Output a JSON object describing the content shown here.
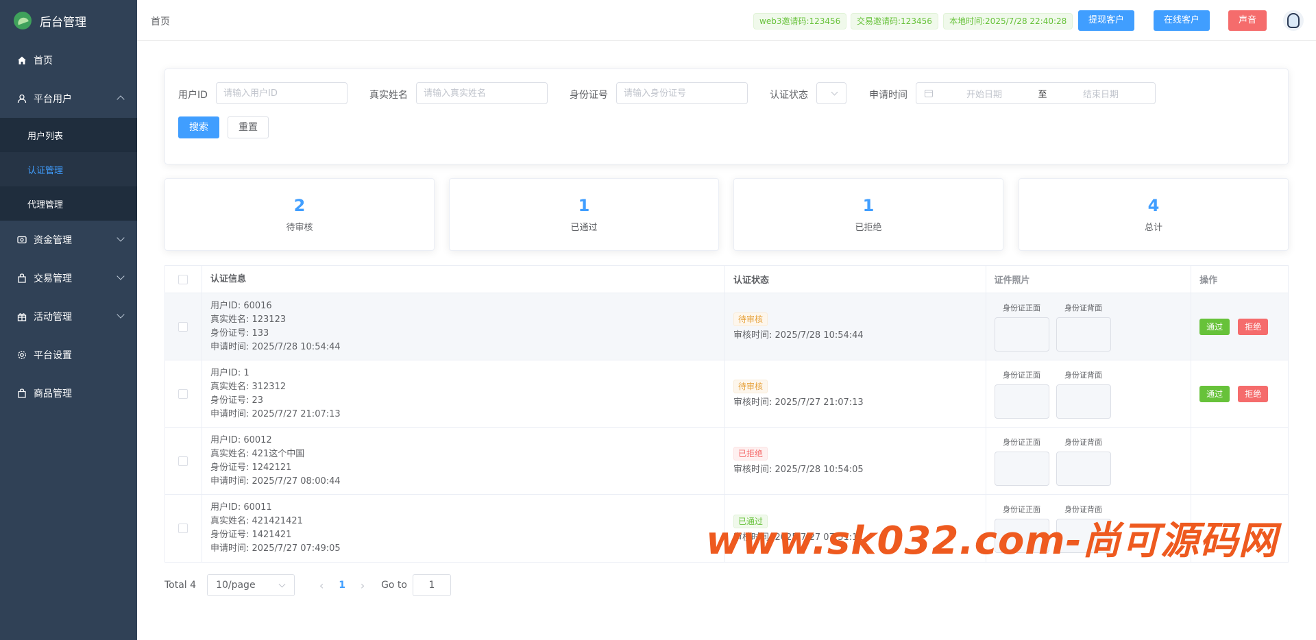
{
  "app": {
    "title": "后台管理"
  },
  "sidebar": {
    "items": [
      {
        "label": "首页",
        "icon": "home-icon"
      },
      {
        "label": "平台用户",
        "icon": "user-icon",
        "expanded": true,
        "children": [
          {
            "label": "用户列表"
          },
          {
            "label": "认证管理",
            "active": true
          },
          {
            "label": "代理管理"
          }
        ]
      },
      {
        "label": "资金管理",
        "icon": "wallet-icon"
      },
      {
        "label": "交易管理",
        "icon": "trade-icon"
      },
      {
        "label": "活动管理",
        "icon": "gift-icon"
      },
      {
        "label": "平台设置",
        "icon": "gear-icon"
      },
      {
        "label": "商品管理",
        "icon": "bag-icon"
      }
    ]
  },
  "header": {
    "breadcrumb": "首页",
    "web3_invite": "web3邀请码:123456",
    "trade_invite": "交易邀请码:123456",
    "local_time": "本地时间:2025/7/28 22:40:28",
    "btn_withdraw": "提现客户",
    "btn_online": "在线客户",
    "btn_sound": "声音"
  },
  "search": {
    "user_id_label": "用户ID",
    "user_id_placeholder": "请输入用户ID",
    "real_name_label": "真实姓名",
    "real_name_placeholder": "请输入真实姓名",
    "id_number_label": "身份证号",
    "id_number_placeholder": "请输入身份证号",
    "status_label": "认证状态",
    "apply_time_label": "申请时间",
    "date_start": "开始日期",
    "date_sep": "至",
    "date_end": "结束日期",
    "search_btn": "搜索",
    "reset_btn": "重置"
  },
  "stats": [
    {
      "value": "2",
      "label": "待审核"
    },
    {
      "value": "1",
      "label": "已通过"
    },
    {
      "value": "1",
      "label": "已拒绝"
    },
    {
      "value": "4",
      "label": "总计"
    }
  ],
  "table": {
    "headers": {
      "info": "认证信息",
      "status": "认证状态",
      "photos": "证件照片",
      "ops": "操作"
    },
    "photo_front": "身份证正面",
    "photo_back": "身份证背面",
    "pass_label": "通过",
    "reject_label": "拒绝",
    "rows": [
      {
        "user_id": "用户ID: 60016",
        "name": "真实姓名: 123123",
        "id_no": "身份证号: 133",
        "apply": "申请时间: 2025/7/28 10:54:44",
        "status": "待审核",
        "review": "审核时间: 2025/7/28 10:54:44"
      },
      {
        "user_id": "用户ID: 1",
        "name": "真实姓名: 312312",
        "id_no": "身份证号: 23",
        "apply": "申请时间: 2025/7/27 21:07:13",
        "status": "待审核",
        "review": "审核时间: 2025/7/27 21:07:13"
      },
      {
        "user_id": "用户ID: 60012",
        "name": "真实姓名: 421这个中国",
        "id_no": "身份证号: 1242121",
        "apply": "申请时间: 2025/7/27 08:00:44",
        "status": "已拒绝",
        "review": "审核时间: 2025/7/28 10:54:05"
      },
      {
        "user_id": "用户ID: 60011",
        "name": "真实姓名: 421421421",
        "id_no": "身份证号: 1421421",
        "apply": "申请时间: 2025/7/27 07:49:05",
        "status": "已通过",
        "review": "审核时间: 2025/7/27 07:51:11"
      }
    ]
  },
  "pagination": {
    "total": "Total 4",
    "page_size": "10/page",
    "current": "1",
    "goto_label": "Go to",
    "goto_value": "1"
  },
  "watermark": "www.sk032.com-尚可源码网",
  "colors": {
    "sidebar": "#304156",
    "primary": "#409eff",
    "success": "#67c23a",
    "danger": "#f56c6c",
    "warning": "#e6a23c"
  }
}
